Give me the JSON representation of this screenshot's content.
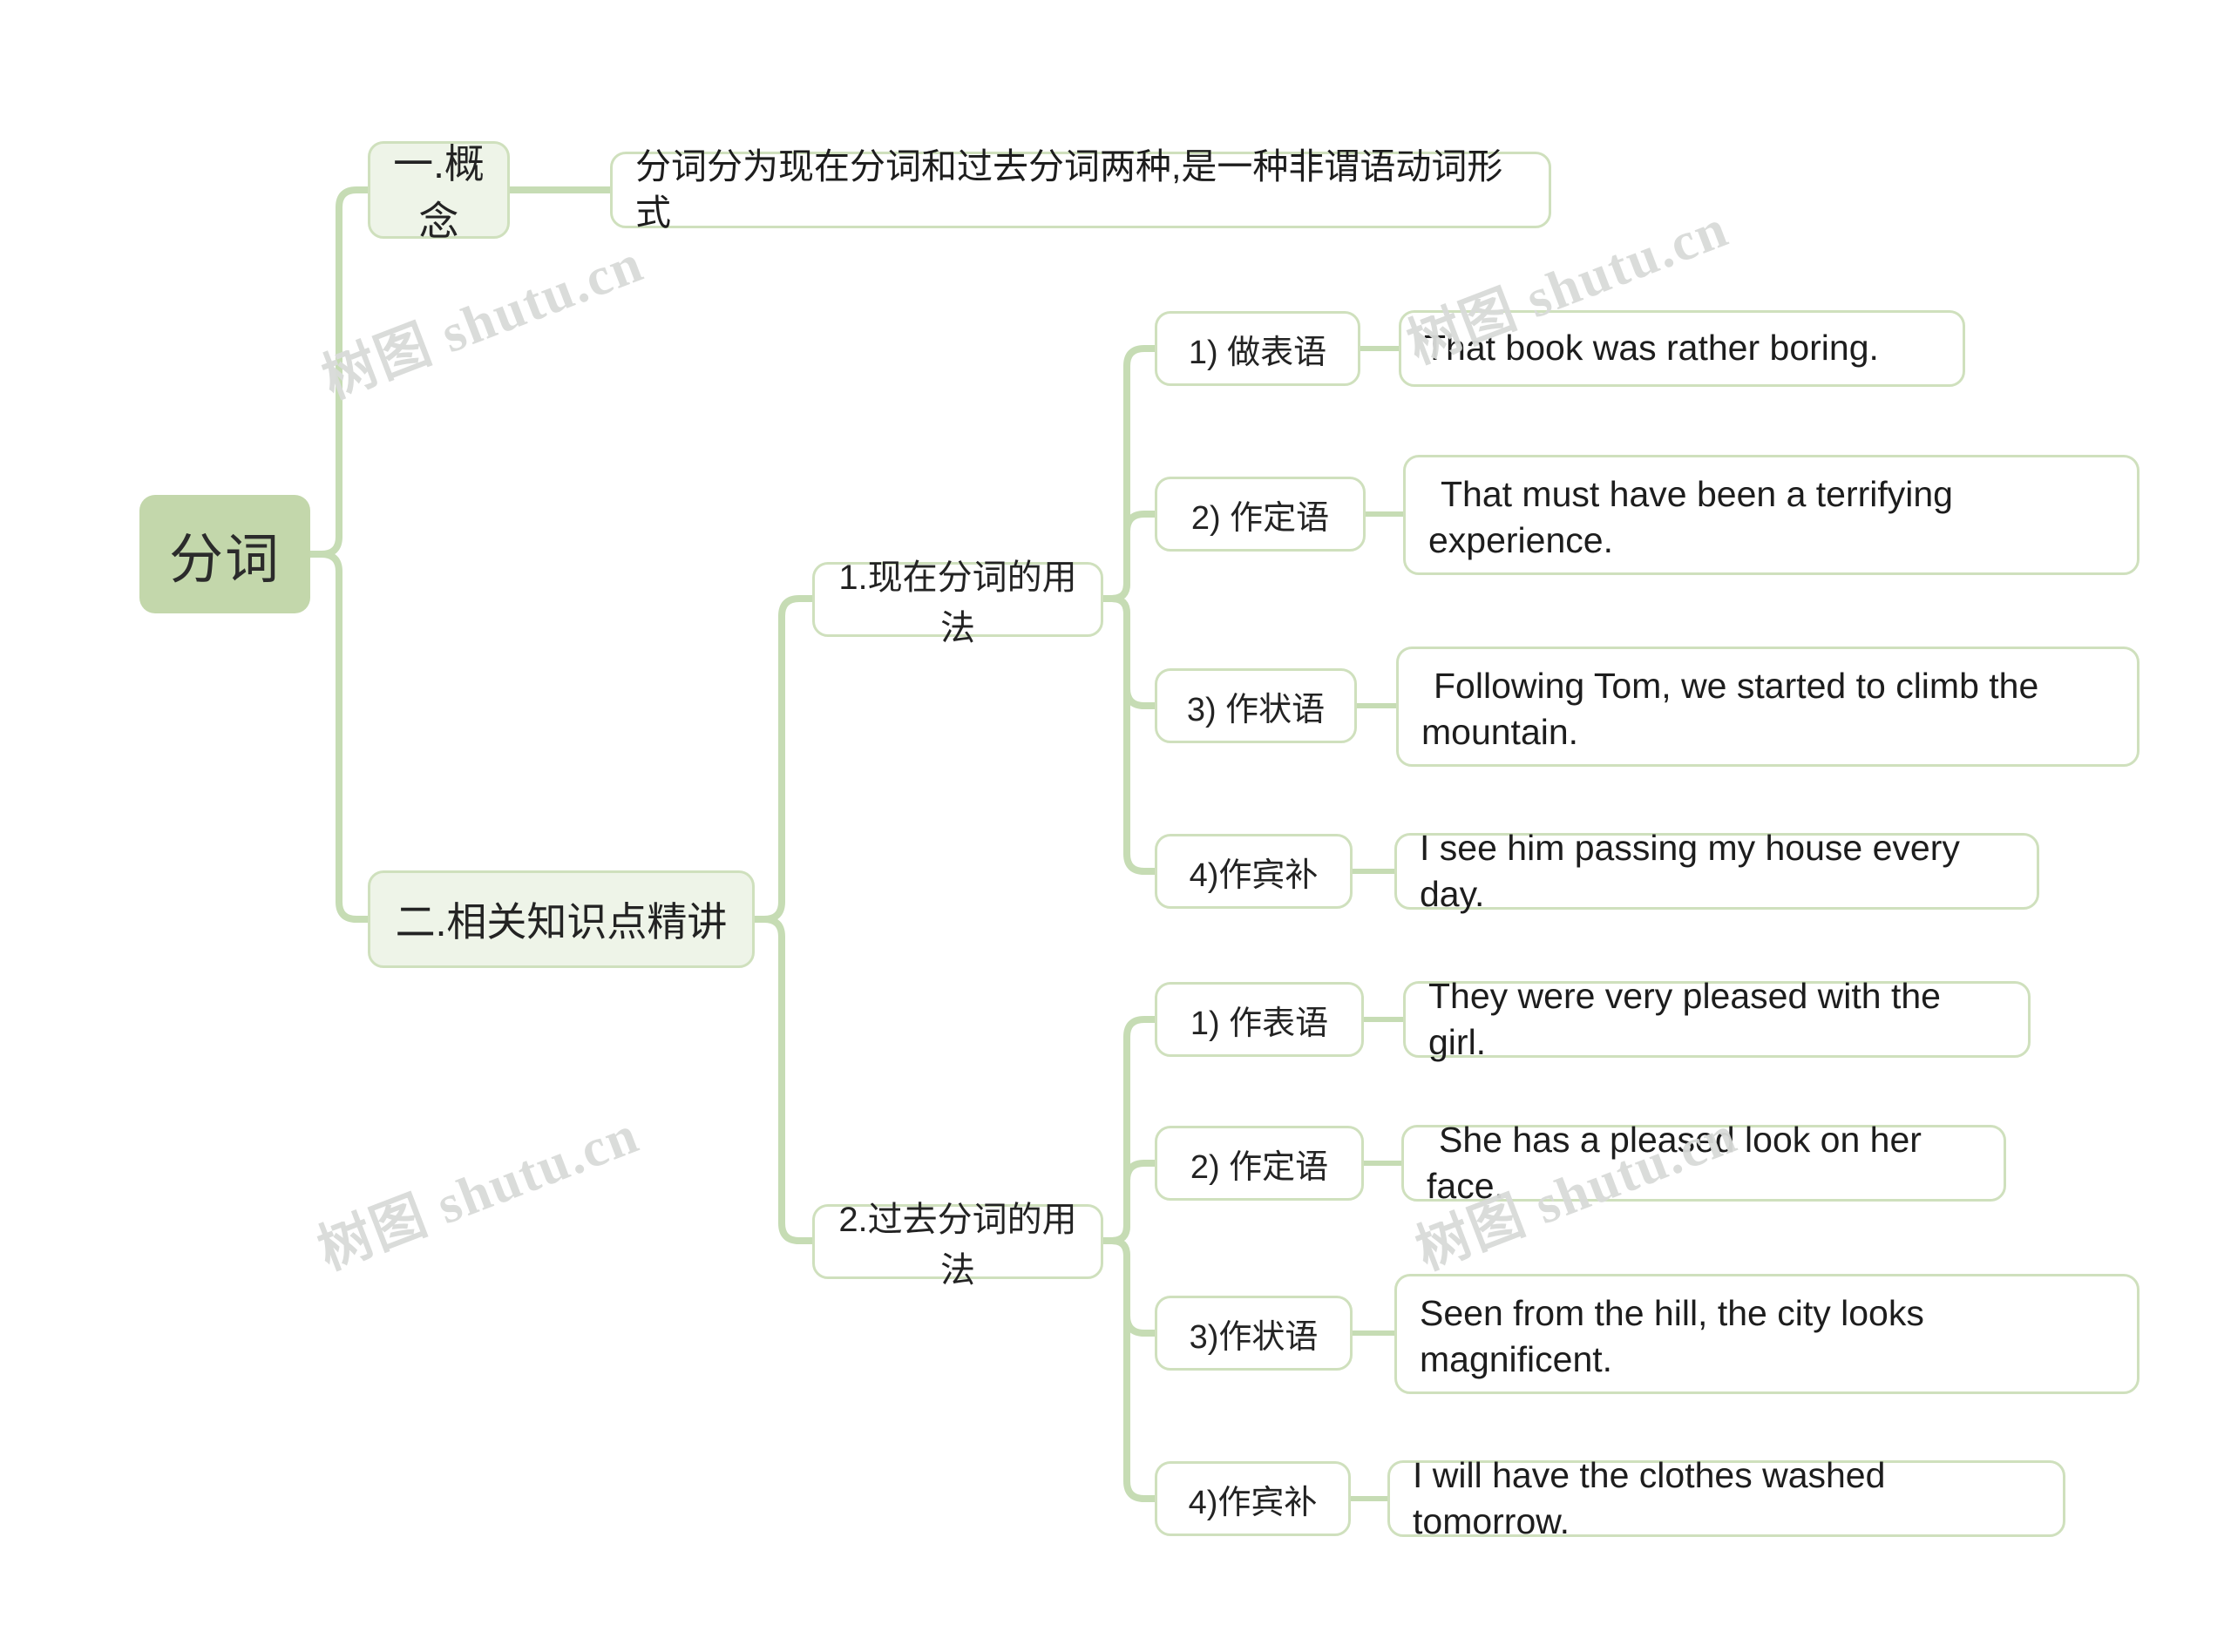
{
  "meta": {
    "watermark_text": "树图 shutu.cn",
    "accent_color": "#c3d7ab",
    "line_color": "#c6dcb4",
    "node_fill_light": "#eef4e8",
    "background": "#ffffff"
  },
  "root": {
    "label": "分词"
  },
  "branches": [
    {
      "label": "一.概念",
      "detail": "分词分为现在分词和过去分词两种,是一种非谓语动词形式"
    },
    {
      "label": "二.相关知识点精讲",
      "groups": [
        {
          "label": "1.现在分词的用法",
          "items": [
            {
              "label": "1) 做表语",
              "example": "That book was rather boring."
            },
            {
              "label": "2) 作定语",
              "example": "That must have been a terrifying experience."
            },
            {
              "label": "3) 作状语",
              "example": "Following Tom, we started to climb the mountain."
            },
            {
              "label": "4)作宾补",
              "example": "I see him passing my house every day."
            }
          ]
        },
        {
          "label": "2.过去分词的用法",
          "items": [
            {
              "label": "1) 作表语",
              "example": "They were very pleased with the girl."
            },
            {
              "label": "2) 作定语",
              "example": "She has a pleased look on her face."
            },
            {
              "label": "3)作状语",
              "example": "Seen from the hill, the city looks magnificent."
            },
            {
              "label": "4)作宾补",
              "example": "I will have the clothes washed tomorrow."
            }
          ]
        }
      ]
    }
  ]
}
